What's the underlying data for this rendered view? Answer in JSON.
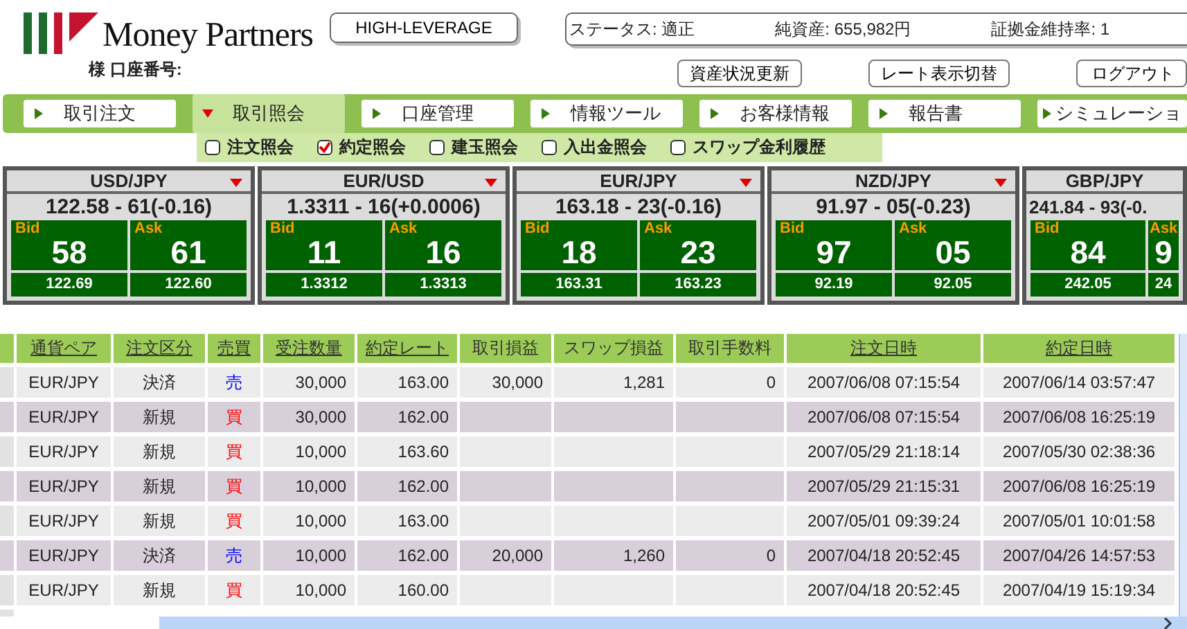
{
  "header": {
    "account_label": "様 口座番号:",
    "leverage_button": "HIGH-LEVERAGE",
    "status": [
      {
        "label": "ステータス: 適正"
      },
      {
        "label": "純資産: 655,982円"
      },
      {
        "label": "証拠金維持率: 1"
      }
    ],
    "buttons": [
      "資産状況更新",
      "レート表示切替",
      "ログアウト"
    ],
    "logo_text": "Money Partners"
  },
  "tabs": [
    {
      "label": "取引注文",
      "selected": false
    },
    {
      "label": "取引照会",
      "selected": true
    },
    {
      "label": "口座管理",
      "selected": false
    },
    {
      "label": "情報ツール",
      "selected": false
    },
    {
      "label": "お客様情報",
      "selected": false
    },
    {
      "label": "報告書",
      "selected": false
    },
    {
      "label": "シミュレーショ",
      "selected": false
    }
  ],
  "subtabs": [
    {
      "label": "注文照会",
      "checked": false
    },
    {
      "label": "約定照会",
      "checked": true
    },
    {
      "label": "建玉照会",
      "checked": false
    },
    {
      "label": "入出金照会",
      "checked": false
    },
    {
      "label": "スワップ金利履歴",
      "checked": false
    }
  ],
  "quotes": [
    {
      "pair": "USD/JPY",
      "price": "122.58 - 61(-0.16)",
      "bid_label": "Bid",
      "bid": "58",
      "ask_label": "Ask",
      "ask": "61",
      "bid_sub": "122.69",
      "ask_sub": "122.60",
      "menu": true
    },
    {
      "pair": "EUR/USD",
      "price": "1.3311 - 16(+0.0006)",
      "bid_label": "Bid",
      "bid": "11",
      "ask_label": "Ask",
      "ask": "16",
      "bid_sub": "1.3312",
      "ask_sub": "1.3313",
      "menu": true
    },
    {
      "pair": "EUR/JPY",
      "price": "163.18 - 23(-0.16)",
      "bid_label": "Bid",
      "bid": "18",
      "ask_label": "Ask",
      "ask": "23",
      "bid_sub": "163.31",
      "ask_sub": "163.23",
      "menu": true
    },
    {
      "pair": "NZD/JPY",
      "price": "91.97 - 05(-0.23)",
      "bid_label": "Bid",
      "bid": "97",
      "ask_label": "Ask",
      "ask": "05",
      "bid_sub": "92.19",
      "ask_sub": "92.05",
      "menu": true
    },
    {
      "pair": "GBP/JPY",
      "price": "241.84 - 93(-0.",
      "bid_label": "Bid",
      "bid": "84",
      "ask_label": "Ask",
      "ask": "9",
      "bid_sub": "242.05",
      "ask_sub": "24",
      "menu": false
    }
  ],
  "table": {
    "columns": [
      {
        "label": "通貨ペア",
        "sortable": true
      },
      {
        "label": "注文区分",
        "sortable": true
      },
      {
        "label": "売買",
        "sortable": true
      },
      {
        "label": "受注数量",
        "sortable": true
      },
      {
        "label": "約定レート",
        "sortable": true
      },
      {
        "label": "取引損益",
        "sortable": false
      },
      {
        "label": "スワップ損益",
        "sortable": false
      },
      {
        "label": "取引手数料",
        "sortable": false
      },
      {
        "label": "注文日時",
        "sortable": true
      },
      {
        "label": "約定日時",
        "sortable": true
      }
    ],
    "rows": [
      {
        "cells": [
          "EUR/JPY",
          "決済",
          "売",
          "30,000",
          "163.00",
          "30,000",
          "1,281",
          "0",
          "2007/06/08 07:15:54",
          "2007/06/14 03:57:47"
        ],
        "kind": "sell"
      },
      {
        "cells": [
          "EUR/JPY",
          "新規",
          "買",
          "30,000",
          "162.00",
          "",
          "",
          "",
          "2007/06/08 07:15:54",
          "2007/06/08 16:25:19"
        ],
        "kind": "buy"
      },
      {
        "cells": [
          "EUR/JPY",
          "新規",
          "買",
          "10,000",
          "163.60",
          "",
          "",
          "",
          "2007/05/29 21:18:14",
          "2007/05/30 02:38:36"
        ],
        "kind": "buy"
      },
      {
        "cells": [
          "EUR/JPY",
          "新規",
          "買",
          "10,000",
          "162.00",
          "",
          "",
          "",
          "2007/05/29 21:15:31",
          "2007/06/08 16:25:19"
        ],
        "kind": "buy"
      },
      {
        "cells": [
          "EUR/JPY",
          "新規",
          "買",
          "10,000",
          "163.00",
          "",
          "",
          "",
          "2007/05/01 09:39:24",
          "2007/05/01 10:01:58"
        ],
        "kind": "buy"
      },
      {
        "cells": [
          "EUR/JPY",
          "決済",
          "売",
          "10,000",
          "162.00",
          "20,000",
          "1,260",
          "0",
          "2007/04/18 20:52:45",
          "2007/04/26 14:57:53"
        ],
        "kind": "sell"
      },
      {
        "cells": [
          "EUR/JPY",
          "新規",
          "買",
          "10,000",
          "160.00",
          "",
          "",
          "",
          "2007/04/18 20:52:45",
          "2007/04/19 15:19:34"
        ],
        "kind": "buy"
      }
    ]
  }
}
